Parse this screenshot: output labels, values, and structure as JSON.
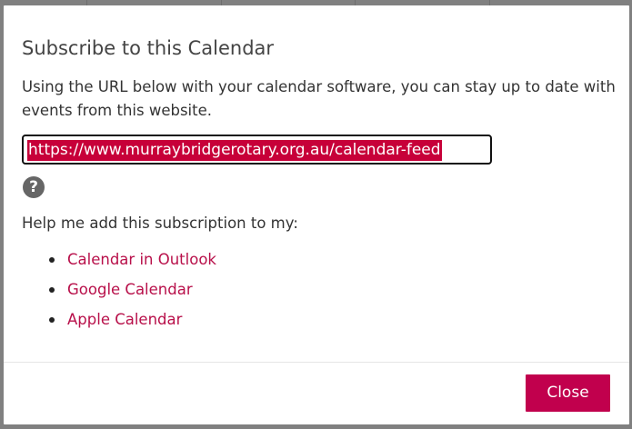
{
  "dialog": {
    "title": "Subscribe to this Calendar",
    "intro": "Using the URL below with your calendar software, you can stay up to date with events from this website.",
    "feed_url": "https://www.murraybridgerotary.org.au/calendar-feed",
    "help_icon": "question-circle-icon",
    "subscribe_label": "Help me add this subscription to my:",
    "links": [
      {
        "label": "Calendar in Outlook"
      },
      {
        "label": "Google Calendar"
      },
      {
        "label": "Apple Calendar"
      }
    ],
    "close_label": "Close"
  },
  "colors": {
    "accent": "#c1004d",
    "link": "#b8104a",
    "selection": "#c70039",
    "title_text": "#444444",
    "body_text": "#333333"
  }
}
